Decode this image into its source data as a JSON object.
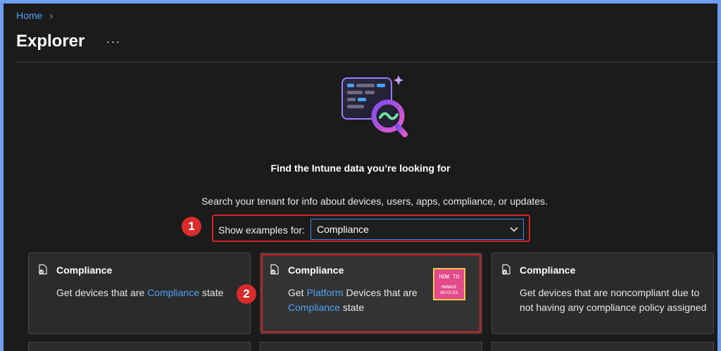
{
  "breadcrumb": {
    "home": "Home",
    "separator": "›"
  },
  "page": {
    "title": "Explorer",
    "more": "···"
  },
  "hero": {
    "icon": "search-data-icon",
    "heading": "Find the Intune data you’re looking for",
    "subtext": "Search your tenant for info about devices, users, apps, compliance, or updates."
  },
  "filter": {
    "label": "Show examples for:",
    "value": "Compliance"
  },
  "markers": {
    "one": "1",
    "two": "2"
  },
  "cards": [
    {
      "icon": "document-check-icon",
      "title": "Compliance",
      "desc_pre": "Get devices that are ",
      "desc_link": "Compliance",
      "desc_post": " state"
    },
    {
      "icon": "document-check-icon",
      "title": "Compliance",
      "desc_pre": "Get ",
      "desc_link": "Platform",
      "desc_mid": " Devices that are",
      "desc_link2": "Compliance",
      "desc_post": " state",
      "logo": {
        "top": "HOW TO",
        "bottom": "MANAGE DEVICES"
      }
    },
    {
      "icon": "document-check-icon",
      "title": "Compliance",
      "desc": "Get devices that are noncompliant due to not having any compliance policy assigned"
    }
  ],
  "colors": {
    "accent_link": "#4fa3f5",
    "highlight": "#d8202b",
    "marker": "#d92b2b",
    "background": "#1b1b1b"
  }
}
